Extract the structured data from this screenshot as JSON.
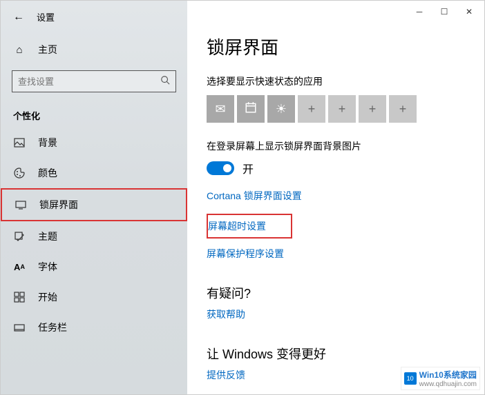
{
  "titlebar": {
    "settings_label": "设置"
  },
  "sidebar": {
    "home_label": "主页",
    "search_placeholder": "查找设置",
    "section_label": "个性化",
    "items": [
      {
        "label": "背景"
      },
      {
        "label": "颜色"
      },
      {
        "label": "锁屏界面"
      },
      {
        "label": "主题"
      },
      {
        "label": "字体"
      },
      {
        "label": "开始"
      },
      {
        "label": "任务栏"
      }
    ]
  },
  "content": {
    "page_title": "锁屏界面",
    "quick_status_label": "选择要显示快速状态的应用",
    "login_bg_label": "在登录屏幕上显示锁屏界面背景图片",
    "toggle_label": "开",
    "links": {
      "cortana": "Cortana 锁屏界面设置",
      "timeout": "屏幕超时设置",
      "screensaver": "屏幕保护程序设置"
    },
    "help_title": "有疑问?",
    "help_link": "获取帮助",
    "feedback_title": "让 Windows 变得更好",
    "feedback_link": "提供反馈"
  },
  "watermark": {
    "logo_text": "10",
    "brand": "Win10系统家园",
    "url": "www.qdhuajin.com"
  }
}
